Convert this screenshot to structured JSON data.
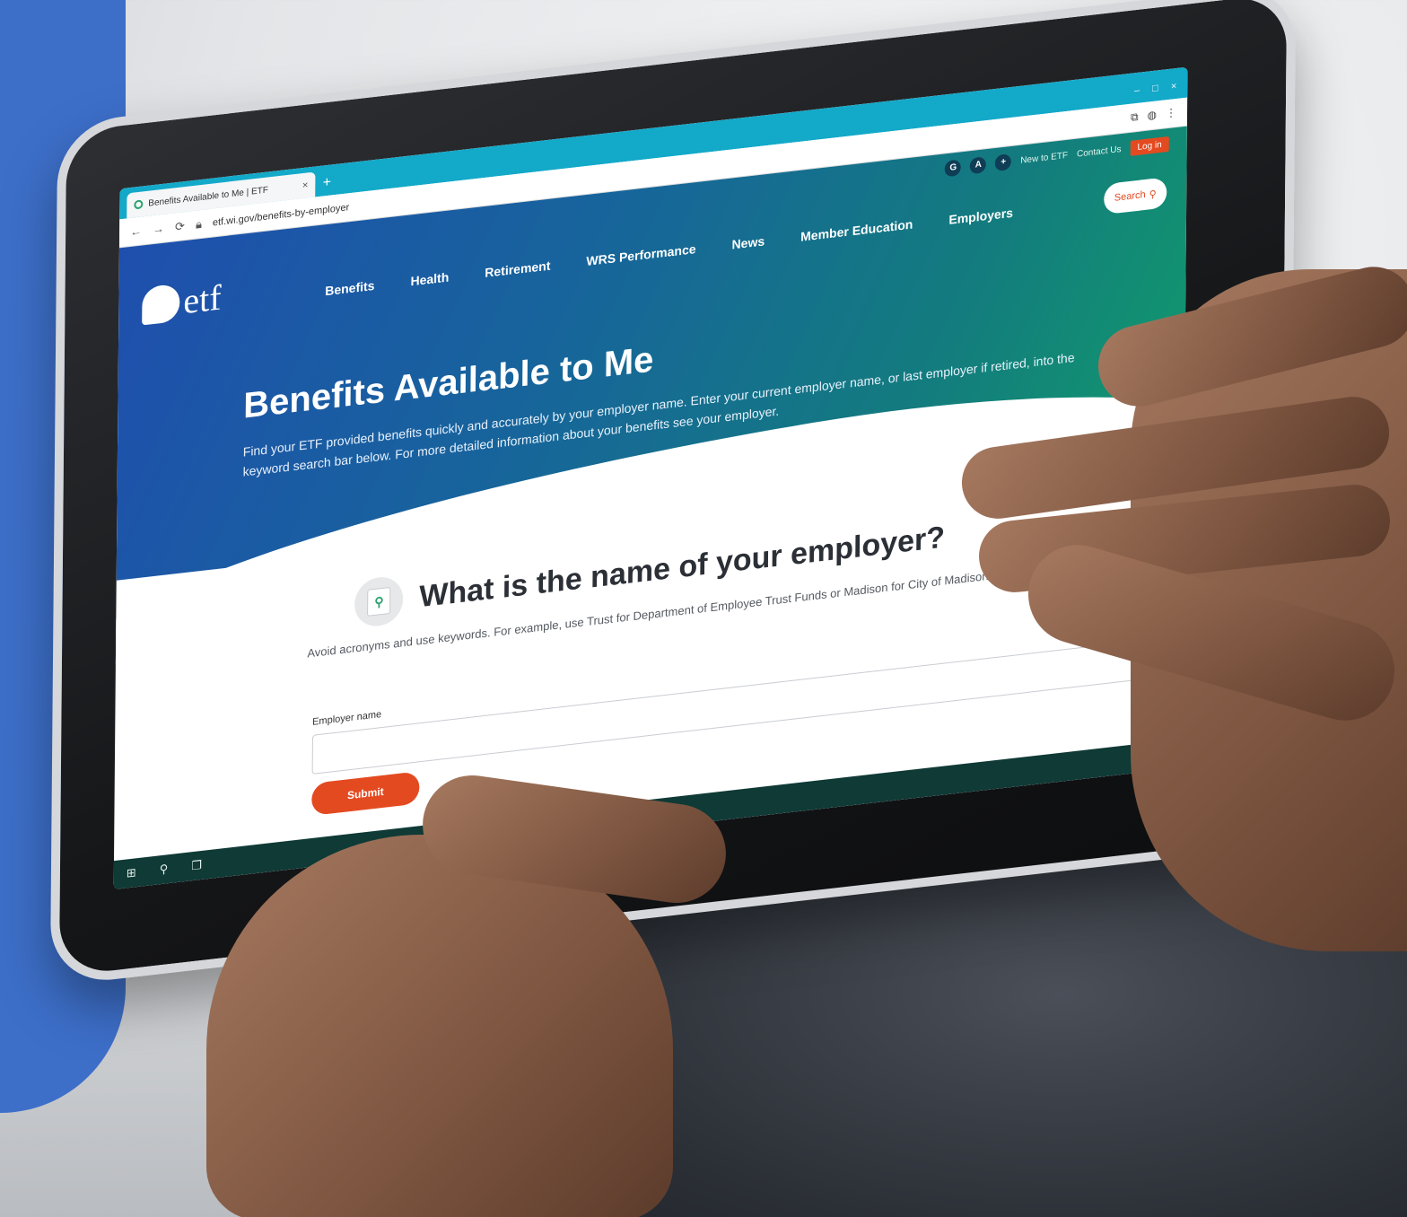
{
  "browser": {
    "tab_title": "Benefits Available to Me | ETF",
    "tab_close": "×",
    "new_tab": "+",
    "url": "etf.wi.gov/benefits-by-employer",
    "window_controls": [
      "–",
      "□",
      "×"
    ]
  },
  "site": {
    "logo_text": "etf",
    "utility": {
      "new_to_etf": "New to ETF",
      "contact_us": "Contact Us",
      "login": "Log in"
    },
    "nav": [
      "Benefits",
      "Health",
      "Retirement",
      "WRS Performance",
      "News",
      "Member Education",
      "Employers"
    ],
    "search_label": "Search"
  },
  "hero": {
    "title": "Benefits Available to Me",
    "description": "Find your ETF provided benefits quickly and accurately by your employer name. Enter your current employer name, or last employer if retired, into the keyword search bar below. For more detailed information about your benefits see your employer."
  },
  "question": {
    "title": "What is the name of your employer?",
    "hint": "Avoid acronyms and use keywords. For example, use Trust for Department of Employee Trust Funds or Madison for City of Madison."
  },
  "form": {
    "employer_label": "Employer name",
    "employer_value": "",
    "employer_placeholder": "",
    "submit_label": "Submit"
  },
  "colors": {
    "accent": "#e44a20",
    "brand_blue": "#1f4fae",
    "brand_green": "#129a6c",
    "side_panel": "#3d6fc9"
  }
}
